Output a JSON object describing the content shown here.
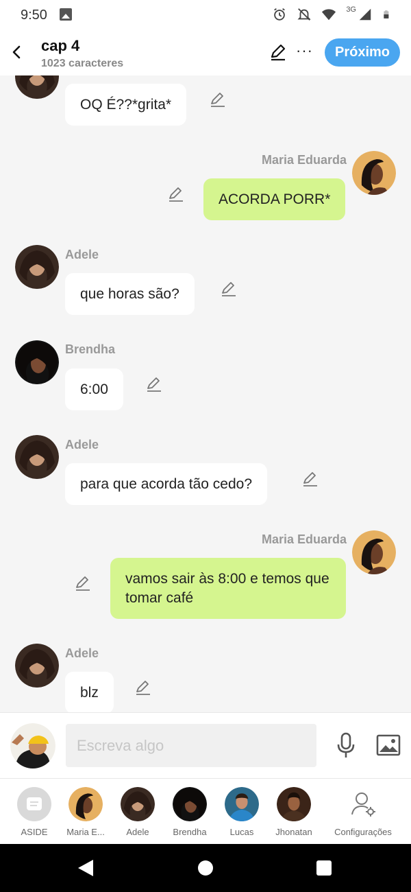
{
  "status_bar": {
    "time": "9:50",
    "network": "3G"
  },
  "header": {
    "title": "cap 4",
    "subtitle": "1023 caracteres",
    "next_label": "Próximo",
    "accent": "#4aa6f0"
  },
  "messages": [
    {
      "sender": "",
      "side": "left",
      "text": "OQ É??*grita*",
      "avatar": "adele-avatar"
    },
    {
      "sender": "Maria Eduarda",
      "side": "right",
      "text": "ACORDA PORR*",
      "avatar": "maria-avatar"
    },
    {
      "sender": "Adele",
      "side": "left",
      "text": "que horas são?",
      "avatar": "adele-avatar"
    },
    {
      "sender": "Brendha",
      "side": "left",
      "text": "6:00",
      "avatar": "brendha-avatar"
    },
    {
      "sender": "Adele",
      "side": "left",
      "text": "para que acorda tão cedo?",
      "avatar": "adele-avatar"
    },
    {
      "sender": "Maria Eduarda",
      "side": "right",
      "text": "vamos sair às 8:00 e temos que tomar café",
      "avatar": "maria-avatar"
    },
    {
      "sender": "Adele",
      "side": "left",
      "text": "blz",
      "avatar": "adele-avatar"
    }
  ],
  "composer": {
    "placeholder": "Escreva algo"
  },
  "characters": [
    {
      "label": "ASIDE",
      "icon": "aside-icon"
    },
    {
      "label": "Maria E...",
      "icon": "maria-avatar"
    },
    {
      "label": "Adele",
      "icon": "adele-avatar"
    },
    {
      "label": "Brendha",
      "icon": "brendha-avatar"
    },
    {
      "label": "Lucas",
      "icon": "lucas-avatar"
    },
    {
      "label": "Jhonatan",
      "icon": "jhonatan-avatar"
    },
    {
      "label": "Configurações",
      "icon": "settings-user-icon"
    }
  ],
  "colors": {
    "right_bubble": "#d5f58f",
    "left_bubble": "#ffffff",
    "background": "#f5f5f5"
  }
}
